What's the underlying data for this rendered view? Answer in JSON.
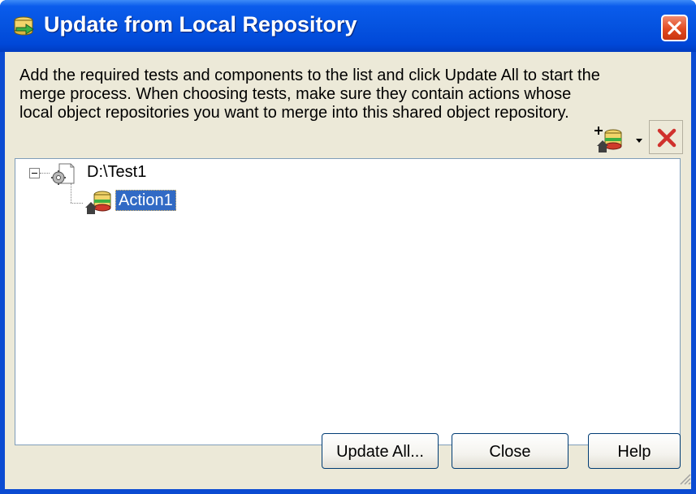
{
  "window": {
    "title": "Update from Local Repository",
    "title_icon": "update-repository-icon",
    "close_icon": "close-icon"
  },
  "instructions": "Add the required tests and components to the list and click Update All to start the merge process. When choosing tests, make sure they contain actions whose local object repositories you want to merge into this shared object repository.",
  "toolbar": {
    "add_icon": "add-action-icon",
    "dropdown_icon": "dropdown-arrow-icon",
    "delete_icon": "delete-icon"
  },
  "tree": {
    "nodes": [
      {
        "label": "D:\\Test1",
        "icon": "test-icon",
        "expanded": true
      },
      {
        "label": "Action1",
        "icon": "action-icon",
        "selected": true
      }
    ]
  },
  "buttons": {
    "update_all": "Update All...",
    "close": "Close",
    "help": "Help"
  },
  "colors": {
    "titlebar": "#0553e0",
    "dialog_bg": "#ece9d8",
    "selection": "#316ac5",
    "close_button": "#e24a20",
    "delete_x": "#d0312d"
  }
}
